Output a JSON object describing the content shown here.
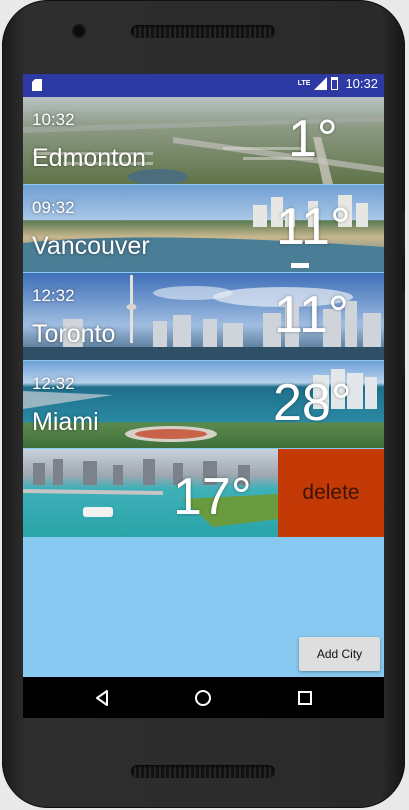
{
  "status_bar": {
    "time": "10:32",
    "network": "LTE",
    "icons": [
      "sd-card-icon",
      "signal-icon",
      "battery-icon"
    ]
  },
  "cities": [
    {
      "time": "10:32",
      "name": "Edmonton",
      "temp": "1°"
    },
    {
      "time": "09:32",
      "name": "Vancouver",
      "temp": "11°"
    },
    {
      "time": "12:32",
      "name": "Toronto",
      "temp": "11°"
    },
    {
      "time": "12:32",
      "name": "Miami",
      "temp": "28°"
    },
    {
      "time": "",
      "name": "",
      "temp": "17°"
    }
  ],
  "delete_label": "delete",
  "add_city_label": "Add City",
  "nav_bar": {
    "icons": [
      "back-icon",
      "home-icon",
      "recents-icon"
    ]
  },
  "colors": {
    "status_bar": "#2d3aa4",
    "screen_background": "#87c9f0",
    "delete": "#c43a07"
  }
}
